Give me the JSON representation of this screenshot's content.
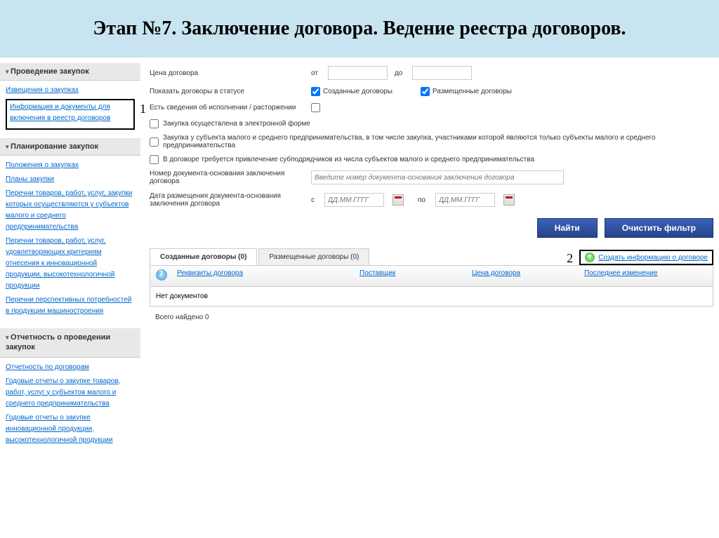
{
  "title": "Этап №7. Заключение договора. Ведение реестра договоров.",
  "markers": {
    "one": "1",
    "two": "2"
  },
  "sidebar": {
    "section1": {
      "title": "Проведение закупок",
      "links": [
        "Извещения о закупках",
        "Информация и документы для включения в реестр договоров"
      ]
    },
    "section2": {
      "title": "Планирование закупок",
      "links": [
        "Положения о закупках",
        "Планы закупки",
        "Перечни товаров, работ, услуг, закупки которых осуществляются у субъектов малого и среднего предпринимательства",
        "Перечни товаров, работ, услуг, удовлетворяющих критериям отнесения к инновационной продукции, высокотехнологичной продукции",
        "Перечни перспективных потребностей в продукции машиностроения"
      ]
    },
    "section3": {
      "title": "Отчетность о проведении закупок",
      "links": [
        "Отчетность по договорам",
        "Годовые отчеты о закупке товаров, работ, услуг у субъектов малого и среднего предпринимательства",
        "Годовые отчеты о закупке инновационной продукции, высокотехнологичной продукции"
      ]
    }
  },
  "filter": {
    "price_label": "Цена договора",
    "from": "от",
    "to": "до",
    "status_label": "Показать договоры в статусе",
    "status_created": "Созданные договоры",
    "status_placed": "Размещенные договоры",
    "exec_label": "Есть сведения об исполнении / расторжении",
    "cb1": "Закупка осуществлена в электронной форме",
    "cb2": "Закупка у субъекта малого и среднего предпринимательства, в том числе закупка, участниками которой являются только субъекты малого и среднего предпринимательства",
    "cb3": "В договоре требуется привлечение субподрядчиков из числа субъектов малого и среднего предпринимательства",
    "docnum_label": "Номер документа-основания заключения договора",
    "docnum_placeholder": "Введите номер документа-основания заключения договора",
    "docdate_label": "Дата размещения документа-основания заключения договора",
    "date_from": "с",
    "date_to": "по",
    "date_placeholder": "ДД.ММ.ГГГГ",
    "btn_search": "Найти",
    "btn_clear": "Очистить фильтр"
  },
  "tabs": {
    "created": "Созданные договоры (0)",
    "placed": "Размещенные договоры (0)",
    "create_link": "Создать информацию о договоре"
  },
  "table": {
    "col_rekv": "Реквизиты договора",
    "col_supplier": "Поставщик",
    "col_price": "Цена договора",
    "col_last": "Последнее изменение",
    "empty": "Нет документов",
    "footer": "Всего найдено 0"
  }
}
